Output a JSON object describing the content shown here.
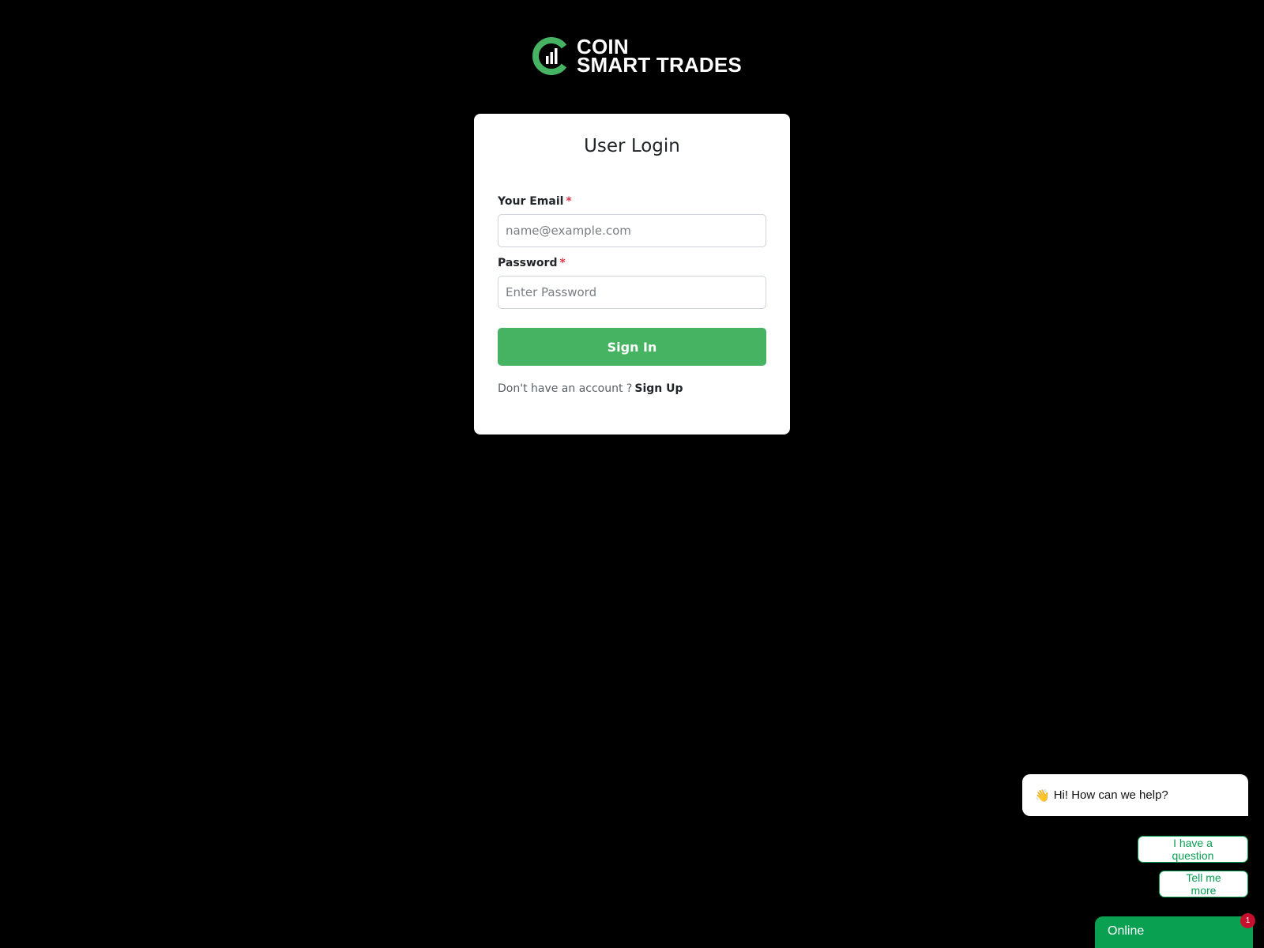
{
  "brand": {
    "line1": "COIN",
    "line2": "SMART TRADES",
    "accent_color": "#45b362"
  },
  "login": {
    "title": "User Login",
    "email_label": "Your Email",
    "email_required_mark": "*",
    "email_placeholder": "name@example.com",
    "email_value": "",
    "password_label": "Password",
    "password_required_mark": "*",
    "password_placeholder": "Enter Password",
    "password_value": "",
    "signin_label": "Sign In",
    "signup_prompt": "Don't have an account ?",
    "signup_link": "Sign Up"
  },
  "chat": {
    "wave_icon": "👋",
    "greeting": "Hi! How can we help?",
    "quick_replies": [
      "I have a question",
      "Tell me more"
    ],
    "status": "Online",
    "unread_count": "1",
    "color": "#0aa052"
  }
}
